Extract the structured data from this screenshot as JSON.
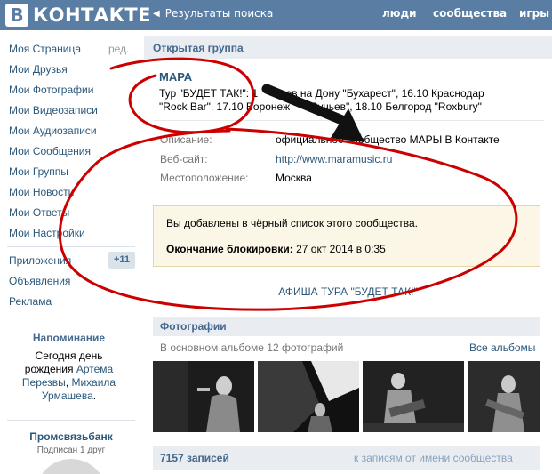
{
  "header": {
    "logo_letter": "В",
    "logo_text": "КОНТАКТЕ",
    "back_label": "Результаты поиска",
    "nav": [
      "люди",
      "сообщества",
      "игры"
    ]
  },
  "left_menu": {
    "items": [
      "Моя Страница",
      "Мои Друзья",
      "Мои Фотографии",
      "Мои Видеозаписи",
      "Мои Аудиозаписи",
      "Мои Сообщения",
      "Мои Группы",
      "Мои Новости",
      "Мои Ответы",
      "Мои Настройки"
    ],
    "edit_label": "ред.",
    "extra": [
      "Приложения",
      "Объявления",
      "Реклама"
    ],
    "apps_badge": "+11"
  },
  "reminder": {
    "title": "Напоминание",
    "line1": "Сегодня",
    "line2a": "день",
    "line2b": "рождения",
    "name1": "Артема",
    "name2": "Перезвы",
    "comma": ",",
    "name3": "Михаила",
    "name4": "Урмашева",
    "dot": "."
  },
  "sponsor": {
    "name": "Промсвязьбанк",
    "subtitle": "Подписан 1 друг"
  },
  "group": {
    "type_label": "Открытая группа",
    "name": "МАРА",
    "status_line1": "Тур \"БУДЕТ ТАК!\": 1",
    "status_line1_tail": "стов на Дону \"Бухарест\", 16.10 Краснодар",
    "status_line2": "\"Rock Bar\", 17.10 Воронеж",
    "status_line2_tail": "Ручьев\", 18.10 Белгород \"Roxbury\"",
    "info": [
      {
        "label": "Описание:",
        "value": "официальное сообщество МАРЫ В Контакте"
      },
      {
        "label": "Веб-сайт:",
        "value": "http://www.maramusic.ru"
      },
      {
        "label": "Местоположение:",
        "value": "Москва"
      }
    ]
  },
  "blacklist": {
    "message": "Вы добавлены в чёрный список этого сообщества.",
    "end_label": "Окончание блокировки:",
    "end_value": "27 окт 2014 в 0:35"
  },
  "poster_link": "АФИША ТУРА \"БУДЕТ ТАК!\"",
  "photos": {
    "title": "Фотографии",
    "subtitle": "В основном альбоме 12 фотографий",
    "all_label": "Все альбомы"
  },
  "posts": {
    "count": "7157 записей",
    "link": "к записям от имени сообщества"
  },
  "colors": {
    "header": "#597da3",
    "link": "#2b587a",
    "annotation_red": "#cc0000"
  }
}
